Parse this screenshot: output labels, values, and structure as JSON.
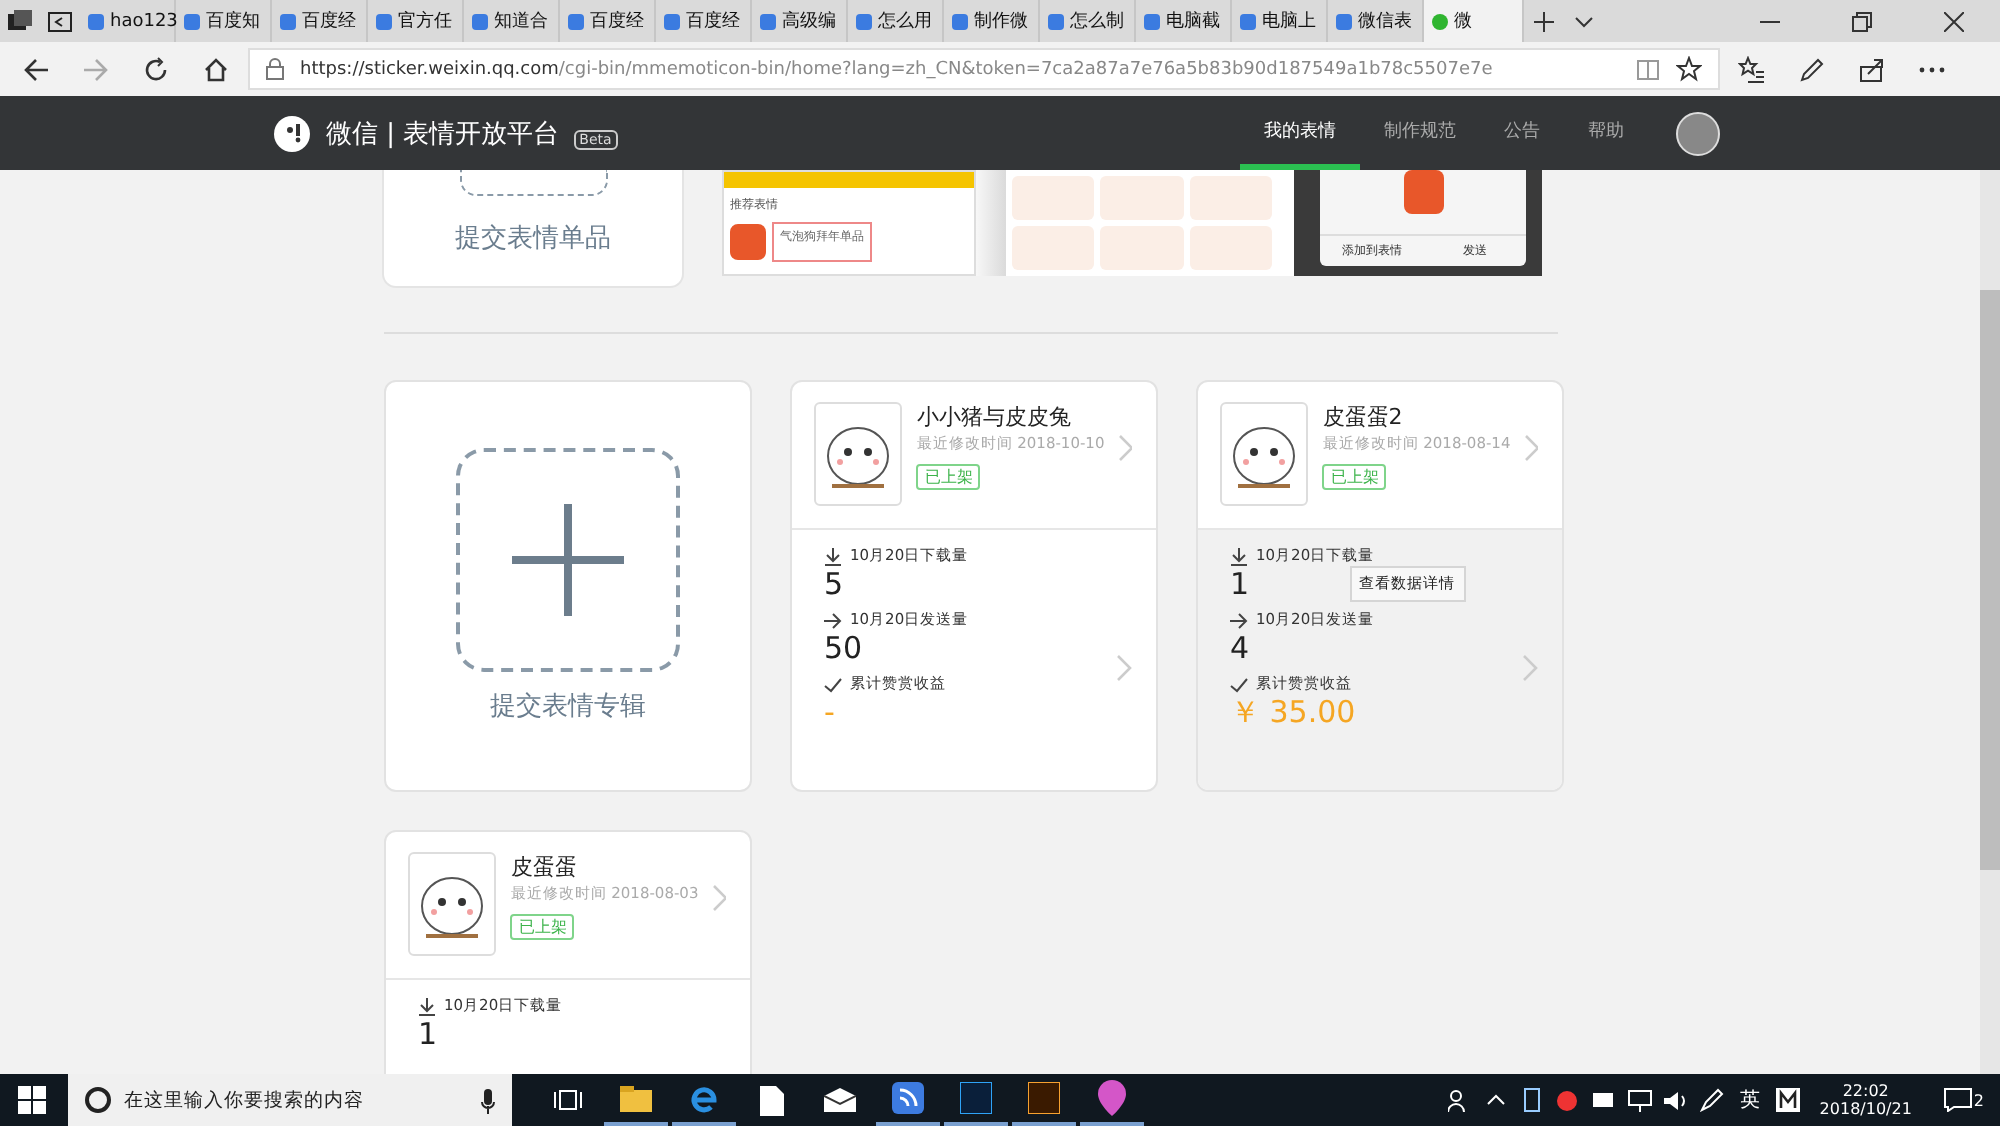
{
  "browser": {
    "tabs": [
      {
        "label": "hao123",
        "selected": false
      },
      {
        "label": "百度知",
        "selected": false
      },
      {
        "label": "百度经",
        "selected": false
      },
      {
        "label": "官方任",
        "selected": false
      },
      {
        "label": "知道合",
        "selected": false
      },
      {
        "label": "百度经",
        "selected": false
      },
      {
        "label": "百度经",
        "selected": false
      },
      {
        "label": "高级编",
        "selected": false
      },
      {
        "label": "怎么用",
        "selected": false
      },
      {
        "label": "制作微",
        "selected": false
      },
      {
        "label": "怎么制",
        "selected": false
      },
      {
        "label": "电脑截",
        "selected": false
      },
      {
        "label": "电脑上",
        "selected": false
      },
      {
        "label": "微信表",
        "selected": false
      },
      {
        "label": "微",
        "selected": true
      }
    ],
    "url_host": "https://sticker.weixin.qq.com",
    "url_path": "/cgi-bin/mmemoticon-bin/home?lang=zh_CN&token=7ca2a87a7e76a5b83b90d187549a1b78c5507e7e"
  },
  "header": {
    "logo_text": "微信 | 表情开放平台",
    "badge": "Beta",
    "nav": [
      {
        "label": "我的表情",
        "selected": true
      },
      {
        "label": "制作规范",
        "selected": false
      },
      {
        "label": "公告",
        "selected": false
      },
      {
        "label": "帮助",
        "selected": false
      }
    ]
  },
  "single_submit": {
    "label": "提交表情单品"
  },
  "preview": {
    "section_label": "推荐表情",
    "item_title": "气泡狗拜年单品",
    "actions": [
      "添加到表情",
      "发送"
    ]
  },
  "album_submit": {
    "label": "提交表情专辑"
  },
  "albums": [
    {
      "title": "小小猪与皮皮兔",
      "modified": "最近修改时间 2018-10-10",
      "status": "已上架",
      "hovered": false,
      "stats": [
        {
          "kind": "download",
          "label": "10月20日下载量",
          "value": "5"
        },
        {
          "kind": "send",
          "label": "10月20日发送量",
          "value": "50"
        },
        {
          "kind": "reward",
          "label": "累计赞赏收益",
          "value": "-"
        }
      ]
    },
    {
      "title": "皮蛋蛋2",
      "modified": "最近修改时间 2018-08-14",
      "status": "已上架",
      "hovered": true,
      "detail_button": "查看数据详情",
      "stats": [
        {
          "kind": "download",
          "label": "10月20日下载量",
          "value": "1"
        },
        {
          "kind": "send",
          "label": "10月20日发送量",
          "value": "4"
        },
        {
          "kind": "reward",
          "label": "累计赞赏收益",
          "value": "￥ 35.00"
        }
      ]
    },
    {
      "title": "皮蛋蛋",
      "modified": "最近修改时间 2018-08-03",
      "status": "已上架",
      "hovered": false,
      "stats": [
        {
          "kind": "download",
          "label": "10月20日下载量",
          "value": "1"
        }
      ]
    }
  ],
  "taskbar": {
    "search_placeholder": "在这里输入你要搜索的内容",
    "ime": "英",
    "time": "22:02",
    "date": "2018/10/21",
    "notifications": "2"
  }
}
